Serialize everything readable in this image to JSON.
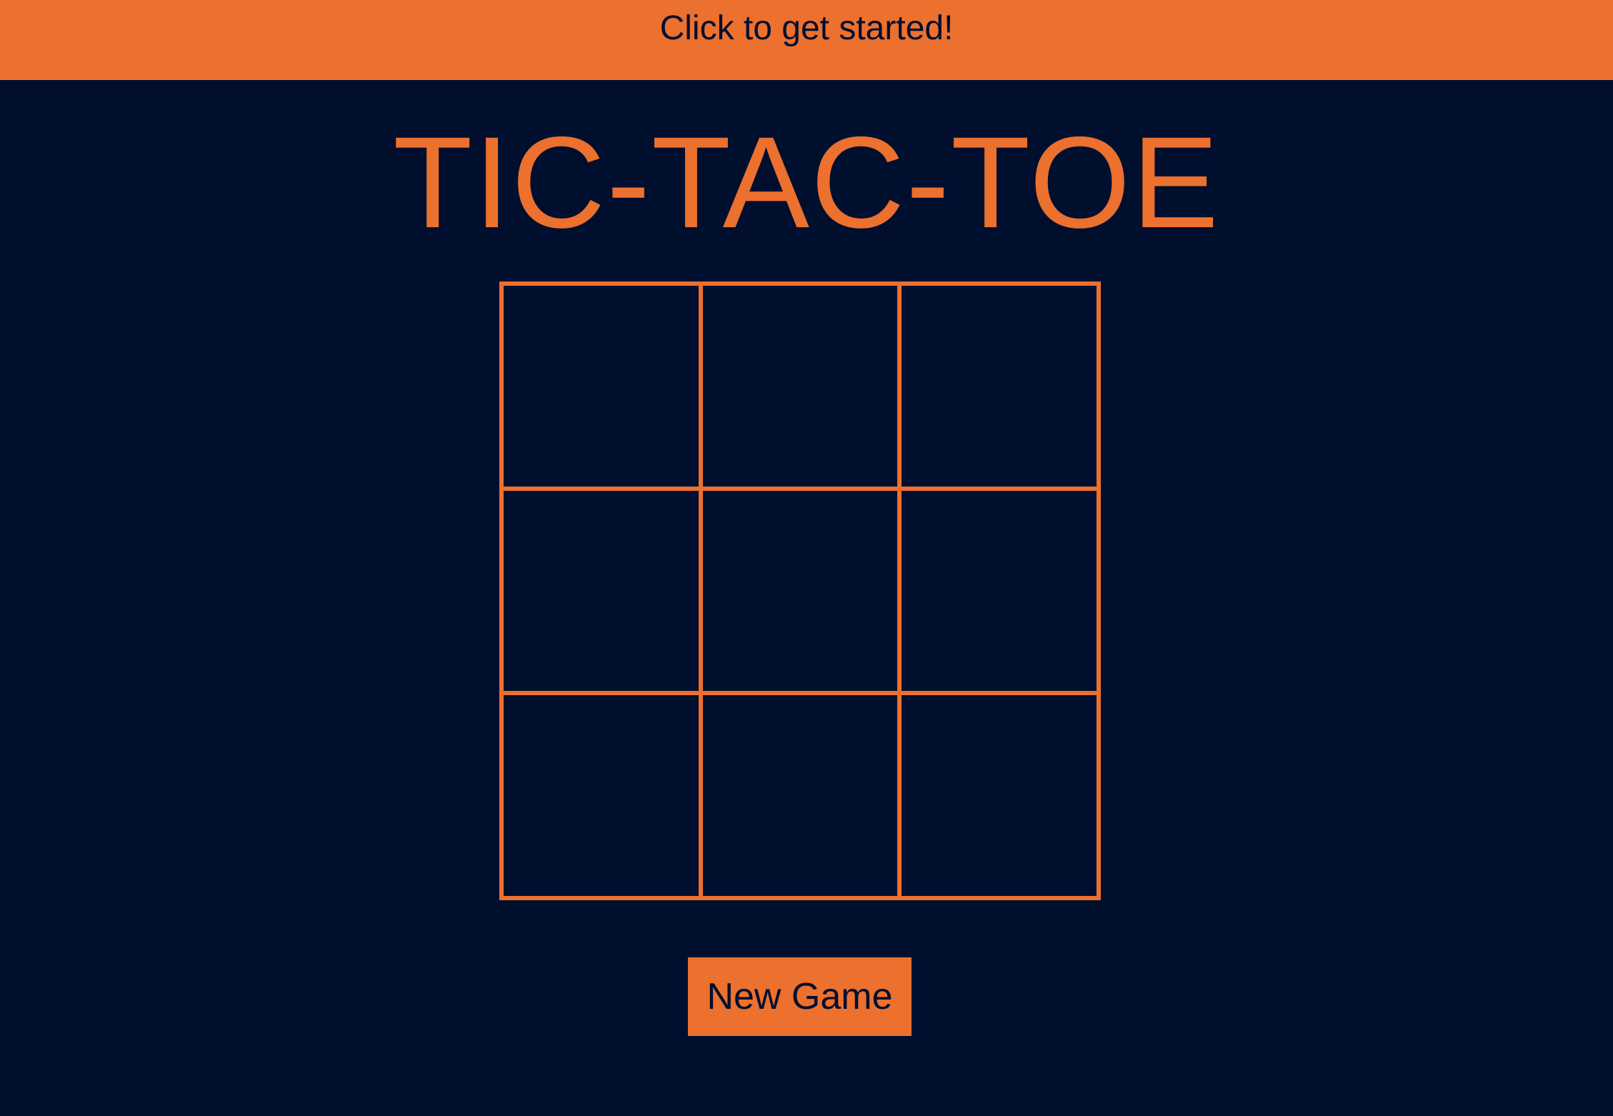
{
  "banner": {
    "message": "Click to get started!"
  },
  "title": "TIC-TAC-TOE",
  "board": {
    "cells": [
      "",
      "",
      "",
      "",
      "",
      "",
      "",
      "",
      ""
    ]
  },
  "controls": {
    "new_game_label": "New Game"
  },
  "colors": {
    "background": "#010f2f",
    "accent": "#ec702e"
  }
}
